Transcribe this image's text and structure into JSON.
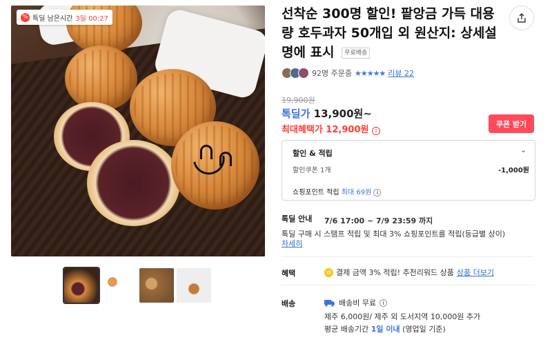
{
  "badge": {
    "prefix": "특딜 남은시간",
    "time": "3일 00:27"
  },
  "product": {
    "title": "선착순 300명 할인! 팥앙금 가득 대용량 호두과자 50개입 외 원산지: 상세설명에 표시",
    "free_ship_tag": "무료배송"
  },
  "meta": {
    "orders": "92명 주문중",
    "stars": "★★★★★",
    "review": "리뷰 22"
  },
  "price": {
    "original": "19,900원",
    "deal_label": "톡딜가",
    "deal_price": "13,900원~",
    "max_label": "최대혜택가",
    "max_price": "12,900원",
    "coupon_button": "쿠폰 받기"
  },
  "benefit_box": {
    "title": "할인 & 적립",
    "coupon_label": "할인쿠폰 1개",
    "coupon_value": "-1,000원",
    "point_label": "쇼핑포인트 적립",
    "point_value": "최대 69원"
  },
  "deal_info": {
    "label": "톡딜 안내",
    "period": "7/6 17:00 ~ 7/9 23:59 까지",
    "desc": "톡딜 구매 시 스탬프 적립 및 최대 3% 쇼핑포인트를 적립(등급별 상이)",
    "more": "자세히"
  },
  "benefit": {
    "label": "혜택",
    "text": "결제 금액 3% 적립! 추천리워드 상품",
    "more": "상품 더보기"
  },
  "shipping": {
    "label": "배송",
    "free": "배송비 무료",
    "jeju": "제주 6,000원/ 제주 외 도서지역 10,000원 추가",
    "avg_prefix": "평균 배송기간",
    "avg_days": "1일 이내",
    "avg_suffix": "(영업일 기준)"
  },
  "colors": {
    "accent_blue": "#3b74e0",
    "accent_red": "#ff3b30",
    "coupon_bg": "#ff4a5a"
  }
}
